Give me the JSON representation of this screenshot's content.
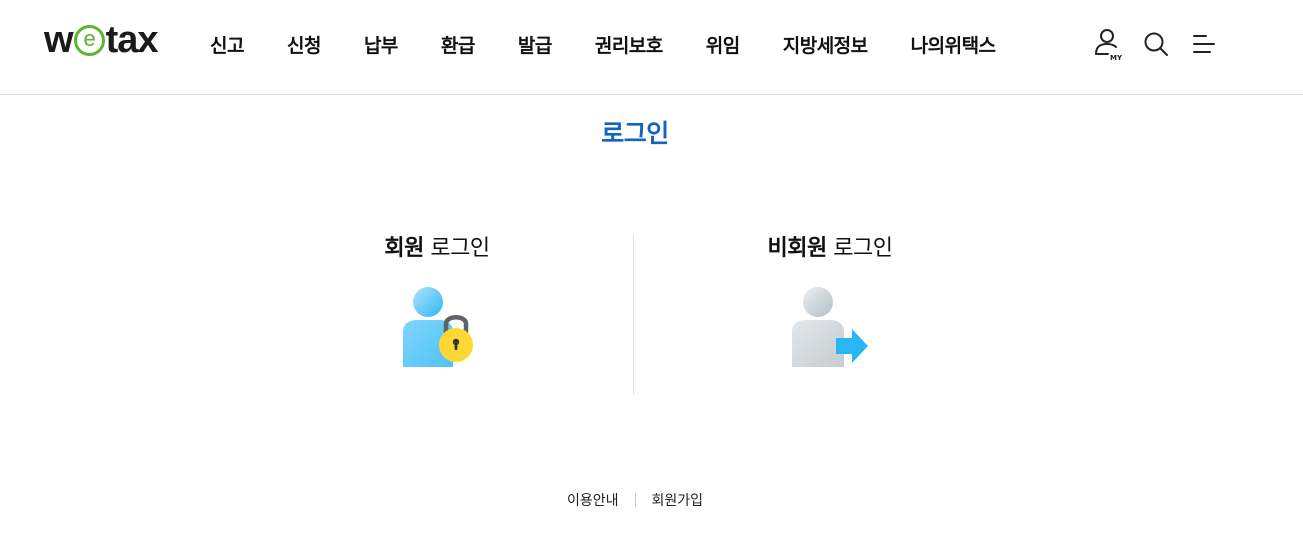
{
  "header": {
    "logo": {
      "text_before": "w",
      "text_e": "e",
      "text_after": "tax"
    },
    "nav": [
      {
        "label": "신고"
      },
      {
        "label": "신청"
      },
      {
        "label": "납부"
      },
      {
        "label": "환급"
      },
      {
        "label": "발급"
      },
      {
        "label": "권리보호"
      },
      {
        "label": "위임"
      },
      {
        "label": "지방세정보"
      },
      {
        "label": "나의위택스"
      }
    ],
    "icons": {
      "my": {
        "name": "user-icon",
        "badge": "MY"
      },
      "search": {
        "name": "search-icon"
      },
      "menu": {
        "name": "menu-icon"
      }
    }
  },
  "main": {
    "title": "로그인",
    "member": {
      "bold": "회원",
      "rest": "로그인",
      "icon": "user-lock-icon"
    },
    "guest": {
      "bold": "비회원",
      "rest": "로그인",
      "icon": "user-arrow-icon"
    }
  },
  "footer": {
    "links": [
      {
        "label": "이용안내"
      },
      {
        "label": "회원가입"
      }
    ]
  },
  "colors": {
    "brand_green": "#5cb531",
    "title_blue": "#1565c0",
    "member_icon_blue": "#4fc3f7",
    "lock_yellow": "#fdd835",
    "guest_icon_gray": "#cfd8dc",
    "arrow_blue": "#29b6f6"
  }
}
